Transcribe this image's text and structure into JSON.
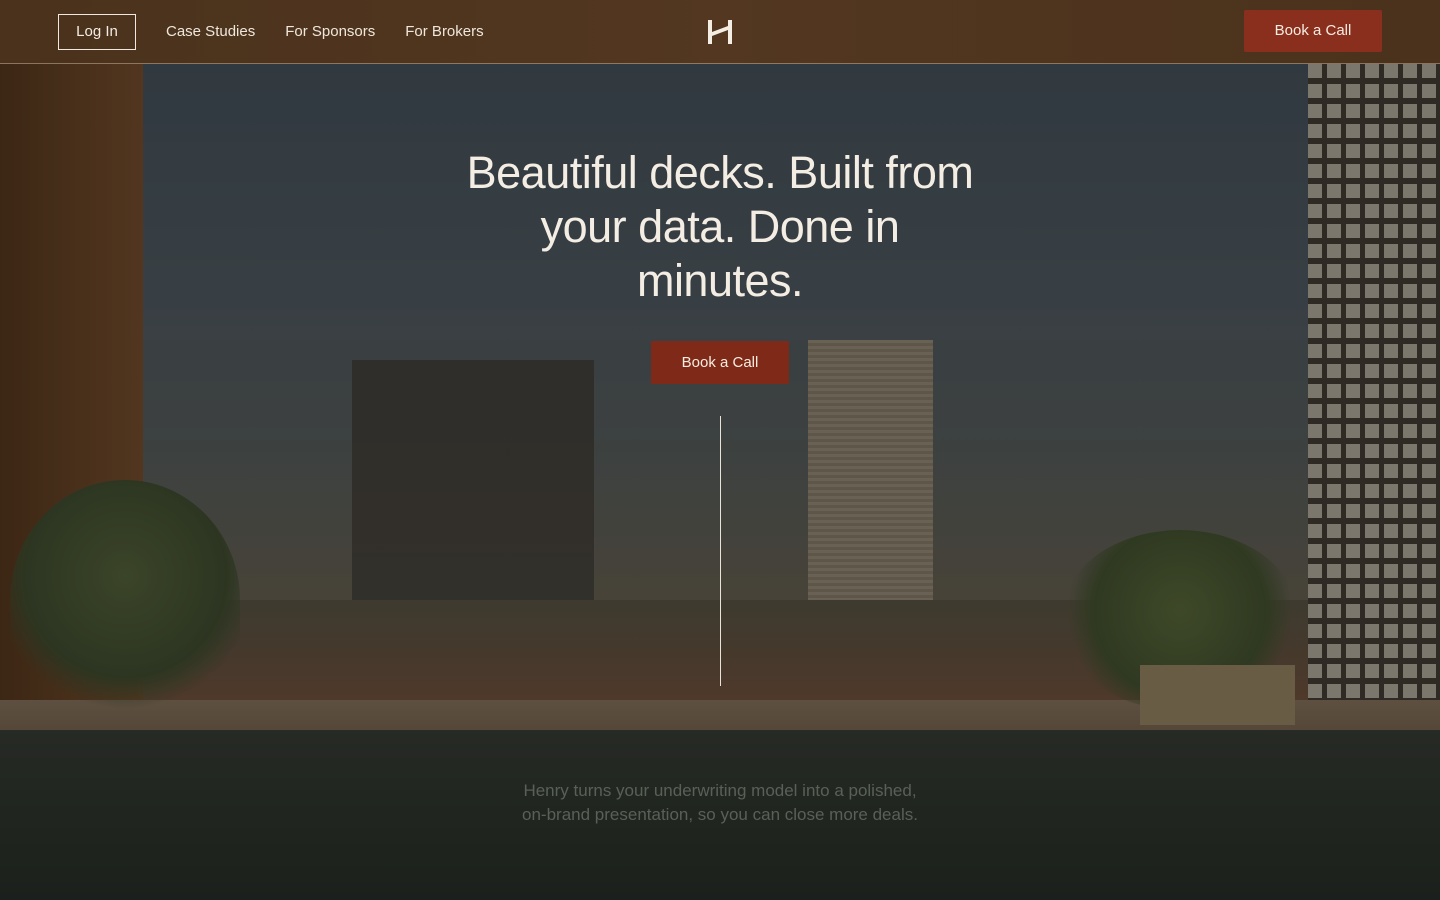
{
  "nav": {
    "login_label": "Log In",
    "links": [
      "Case Studies",
      "For Sponsors",
      "For Brokers"
    ],
    "cta_label": "Book a Call",
    "logo_icon": "h-monogram-logo-icon"
  },
  "hero": {
    "title": "Beautiful decks. Built from your data. Done in minutes.",
    "cta_label": "Book a Call",
    "subtitle": "Henry turns your underwriting model into a polished, on-brand presentation, so you can close more deals."
  },
  "colors": {
    "accent": "#8a2f1d",
    "nav_bg": "#4f351f",
    "text_light": "#f4ede4"
  }
}
